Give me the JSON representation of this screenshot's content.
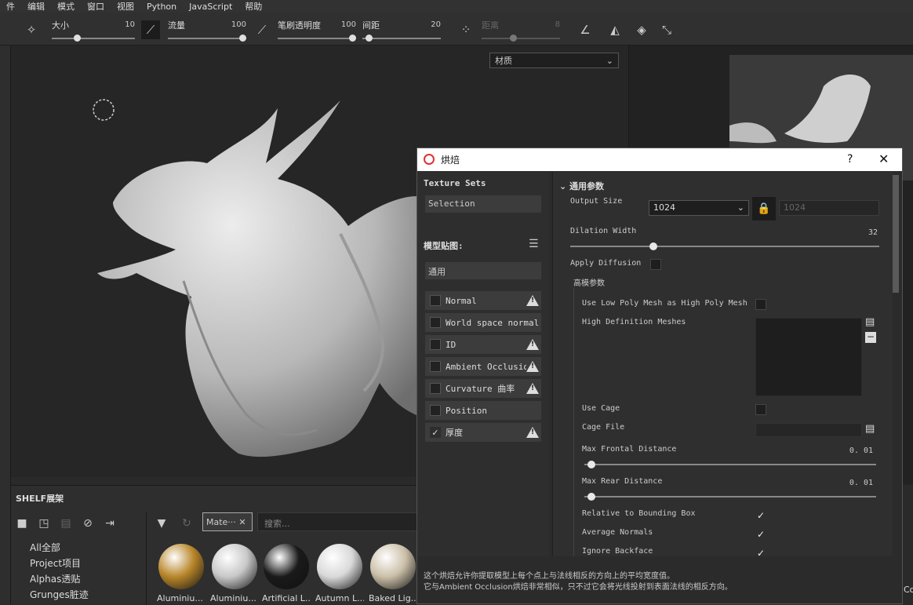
{
  "menu": [
    "件",
    "编辑",
    "模式",
    "窗口",
    "视图",
    "Python",
    "JavaScript",
    "帮助"
  ],
  "toolbar": {
    "size_label": "大小",
    "size_value": "10",
    "size_level": 0.3,
    "flow_label": "流量",
    "flow_value": "100",
    "flow_level": 1.0,
    "opacity_label": "笔刷透明度",
    "opacity_value": "100",
    "opacity_level": 1.0,
    "spacing_label": "间距",
    "spacing_value": "20",
    "spacing_level": 0.08,
    "distance_label": "距离",
    "distance_value": "8",
    "distance_level": 0.4
  },
  "viewport": {
    "material_select": "材质"
  },
  "shelf": {
    "title": "SHELF展架",
    "categories": [
      "All全部",
      "Project项目",
      "Alphas透贴",
      "Grunges脏迹"
    ],
    "tag_label": "Mate···",
    "search_placeholder": "搜索...",
    "materials": [
      {
        "name": "Aluminiu...",
        "color": "#b8862a"
      },
      {
        "name": "Aluminiu...",
        "color": "#c8c8c8"
      },
      {
        "name": "Artificial L...",
        "color": "#1a1a1a"
      },
      {
        "name": "Autumn L...",
        "color": "#d9d9d9"
      },
      {
        "name": "Baked Lig...",
        "color": "#cbbfa8"
      }
    ],
    "partial_label": "Co"
  },
  "dialog": {
    "title": "烘焙",
    "help": "?",
    "texture_sets_header": "Texture Sets",
    "selection_label": "Selection",
    "model_maps_header": "模型贴图:",
    "common_label": "通用",
    "maps": [
      {
        "label": "Normal",
        "checked": false,
        "warn": true
      },
      {
        "label": "World space normal",
        "checked": false,
        "warn": false
      },
      {
        "label": "ID",
        "checked": false,
        "warn": true
      },
      {
        "label": "Ambient Occlusion",
        "checked": false,
        "warn": true
      },
      {
        "label": "Curvature 曲率",
        "checked": false,
        "warn": true
      },
      {
        "label": "Position",
        "checked": false,
        "warn": false
      },
      {
        "label": "厚度",
        "checked": true,
        "warn": true
      }
    ],
    "params_header": "通用参数",
    "output_size_label": "Output Size",
    "output_size_value": "1024",
    "output_size_locked": "1024",
    "dilation_label": "Dilation Width",
    "dilation_value": "32",
    "dilation_level": 0.256,
    "apply_diffusion_label": "Apply Diffusion",
    "hp_header": "高模参数",
    "use_low_poly_label": "Use Low Poly Mesh as High Poly Mesh",
    "hd_meshes_label": "High Definition Meshes",
    "use_cage_label": "Use Cage",
    "cage_file_label": "Cage File",
    "max_frontal_label": "Max Frontal Distance",
    "max_frontal_value": "0. 01",
    "max_frontal_level": 0.01,
    "max_rear_label": "Max Rear Distance",
    "max_rear_value": "0. 01",
    "max_rear_level": 0.01,
    "relative_bbox_label": "Relative to Bounding Box",
    "relative_bbox_checked": true,
    "average_normals_label": "Average Normals",
    "average_normals_checked": true,
    "ignore_backface_label": "Ignore Backface",
    "ignore_backface_checked": true,
    "footer_line1": "这个烘焙允许你提取模型上每个点上与法线相反的方向上的平均宽度值。",
    "footer_line2": "它与Ambient Occlusion烘焙非常相似，只不过它会将光线投射到表面法线的相反方向。"
  }
}
